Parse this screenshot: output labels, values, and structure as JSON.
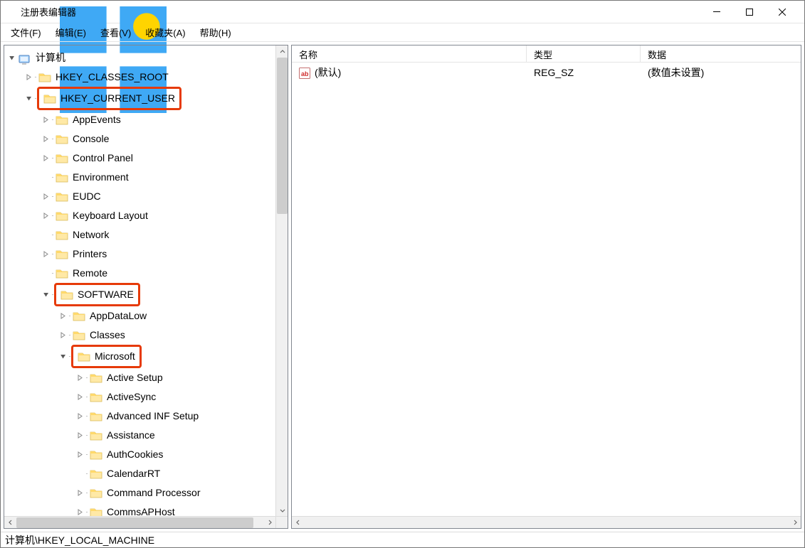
{
  "window": {
    "title": "注册表编辑器"
  },
  "menubar": {
    "file": "文件(F)",
    "edit": "编辑(E)",
    "view": "查看(V)",
    "favorites": "收藏夹(A)",
    "help": "帮助(H)"
  },
  "tree": {
    "root": "计算机",
    "hkcr": "HKEY_CLASSES_ROOT",
    "hkcu": "HKEY_CURRENT_USER",
    "appevents": "AppEvents",
    "console": "Console",
    "controlpanel": "Control Panel",
    "environment": "Environment",
    "eudc": "EUDC",
    "keyboardlayout": "Keyboard Layout",
    "network": "Network",
    "printers": "Printers",
    "remote": "Remote",
    "software": "SOFTWARE",
    "appdatalow": "AppDataLow",
    "classes": "Classes",
    "microsoft": "Microsoft",
    "activesetup": "Active Setup",
    "activesync": "ActiveSync",
    "advancedinfsetup": "Advanced INF Setup",
    "assistance": "Assistance",
    "authcookies": "AuthCookies",
    "calendarrt": "CalendarRT",
    "commandprocessor": "Command Processor",
    "commsaphost": "CommsAPHost"
  },
  "list": {
    "headers": {
      "name": "名称",
      "type": "类型",
      "data": "数据"
    },
    "rows": [
      {
        "name": "(默认)",
        "type": "REG_SZ",
        "data": "(数值未设置)"
      }
    ]
  },
  "statusbar": {
    "path": "计算机\\HKEY_LOCAL_MACHINE"
  }
}
